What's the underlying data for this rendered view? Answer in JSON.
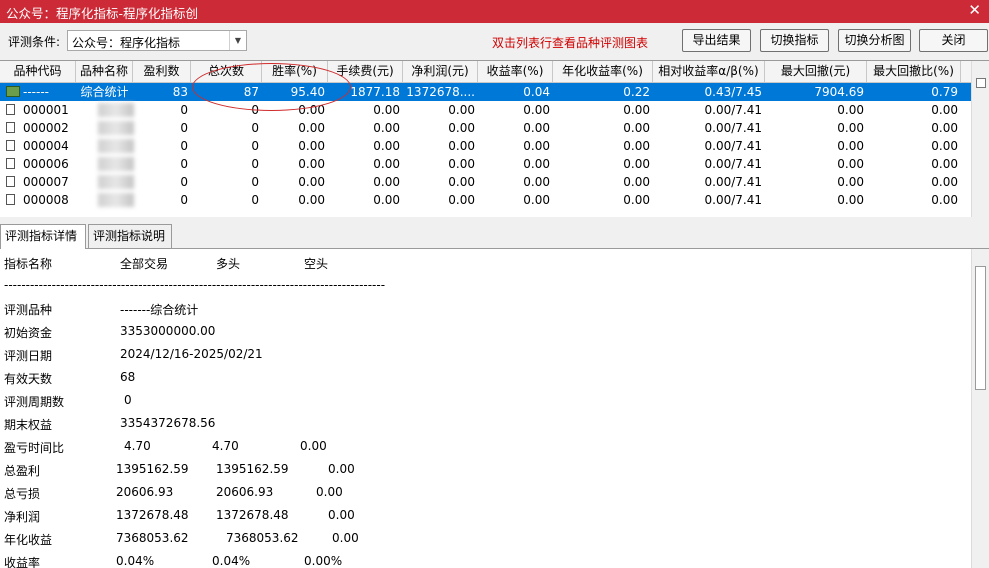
{
  "window": {
    "title": "公众号：程序化指标-程序化指标创",
    "close_glyph": "✕"
  },
  "toolbar": {
    "condition_label": "评测条件:",
    "condition_value": "公众号：程序化指标",
    "hint": "双击列表行查看品种评测图表",
    "buttons": [
      "导出结果",
      "切换指标",
      "切换分析图",
      "关闭"
    ]
  },
  "grid": {
    "columns": [
      "品种代码",
      "品种名称",
      "盈利数",
      "总次数",
      "胜率(%)",
      "手续费(元)",
      "净利润(元)",
      "收益率(%)",
      "年化收益率(%)",
      "相对收益率α/β(%)",
      "最大回撤(元)",
      "最大回撤比(%)"
    ],
    "rows": [
      [
        "------",
        "综合统计",
        "83",
        "87",
        "95.40",
        "1877.18",
        "1372678....",
        "0.04",
        "0.22",
        "0.43/7.45",
        "7904.69",
        "0.79"
      ],
      [
        "000001",
        "",
        "0",
        "0",
        "0.00",
        "0.00",
        "0.00",
        "0.00",
        "0.00",
        "0.00/7.41",
        "0.00",
        "0.00"
      ],
      [
        "000002",
        "",
        "0",
        "0",
        "0.00",
        "0.00",
        "0.00",
        "0.00",
        "0.00",
        "0.00/7.41",
        "0.00",
        "0.00"
      ],
      [
        "000004",
        "",
        "0",
        "0",
        "0.00",
        "0.00",
        "0.00",
        "0.00",
        "0.00",
        "0.00/7.41",
        "0.00",
        "0.00"
      ],
      [
        "000006",
        "",
        "0",
        "0",
        "0.00",
        "0.00",
        "0.00",
        "0.00",
        "0.00",
        "0.00/7.41",
        "0.00",
        "0.00"
      ],
      [
        "000007",
        "",
        "0",
        "0",
        "0.00",
        "0.00",
        "0.00",
        "0.00",
        "0.00",
        "0.00/7.41",
        "0.00",
        "0.00"
      ],
      [
        "000008",
        "",
        "0",
        "0",
        "0.00",
        "0.00",
        "0.00",
        "0.00",
        "0.00",
        "0.00/7.41",
        "0.00",
        "0.00"
      ]
    ],
    "selected_row": 0
  },
  "tabs": [
    "评测指标详情",
    "评测指标说明"
  ],
  "detail": {
    "header": [
      "指标名称",
      "全部交易",
      "多头",
      "空头"
    ],
    "separator": "----------------------------------------------------------------------------------------",
    "items": [
      {
        "name": "评测品种",
        "values": [
          "-------综合统计"
        ]
      },
      {
        "name": "初始资金",
        "values": [
          "3353000000.00"
        ]
      },
      {
        "name": "评测日期",
        "values": [
          "2024/12/16-2025/02/21"
        ]
      },
      {
        "name": "有效天数",
        "values": [
          "68"
        ]
      },
      {
        "name": "评测周期数",
        "values": [
          "0"
        ]
      },
      {
        "name": "期末权益",
        "values": [
          "3354372678.56"
        ]
      },
      {
        "name": "盈亏时间比",
        "values": [
          "4.70",
          "4.70",
          "0.00"
        ]
      },
      {
        "name": "总盈利",
        "values": [
          "1395162.59",
          "1395162.59",
          "0.00"
        ]
      },
      {
        "name": "总亏损",
        "values": [
          "20606.93",
          "20606.93",
          "0.00"
        ]
      },
      {
        "name": "净利润",
        "values": [
          "1372678.48",
          "1372678.48",
          "0.00"
        ]
      },
      {
        "name": "年化收益",
        "values": [
          "7368053.62",
          "7368053.62",
          "0.00"
        ]
      },
      {
        "name": "收益率",
        "values": [
          "0.04%",
          "0.04%",
          "0.00%"
        ]
      }
    ]
  },
  "colors": {
    "title_bg": "#cc2a36",
    "selection": "#0078d7",
    "hint": "#d00000",
    "annotation": "#d02c2c"
  }
}
